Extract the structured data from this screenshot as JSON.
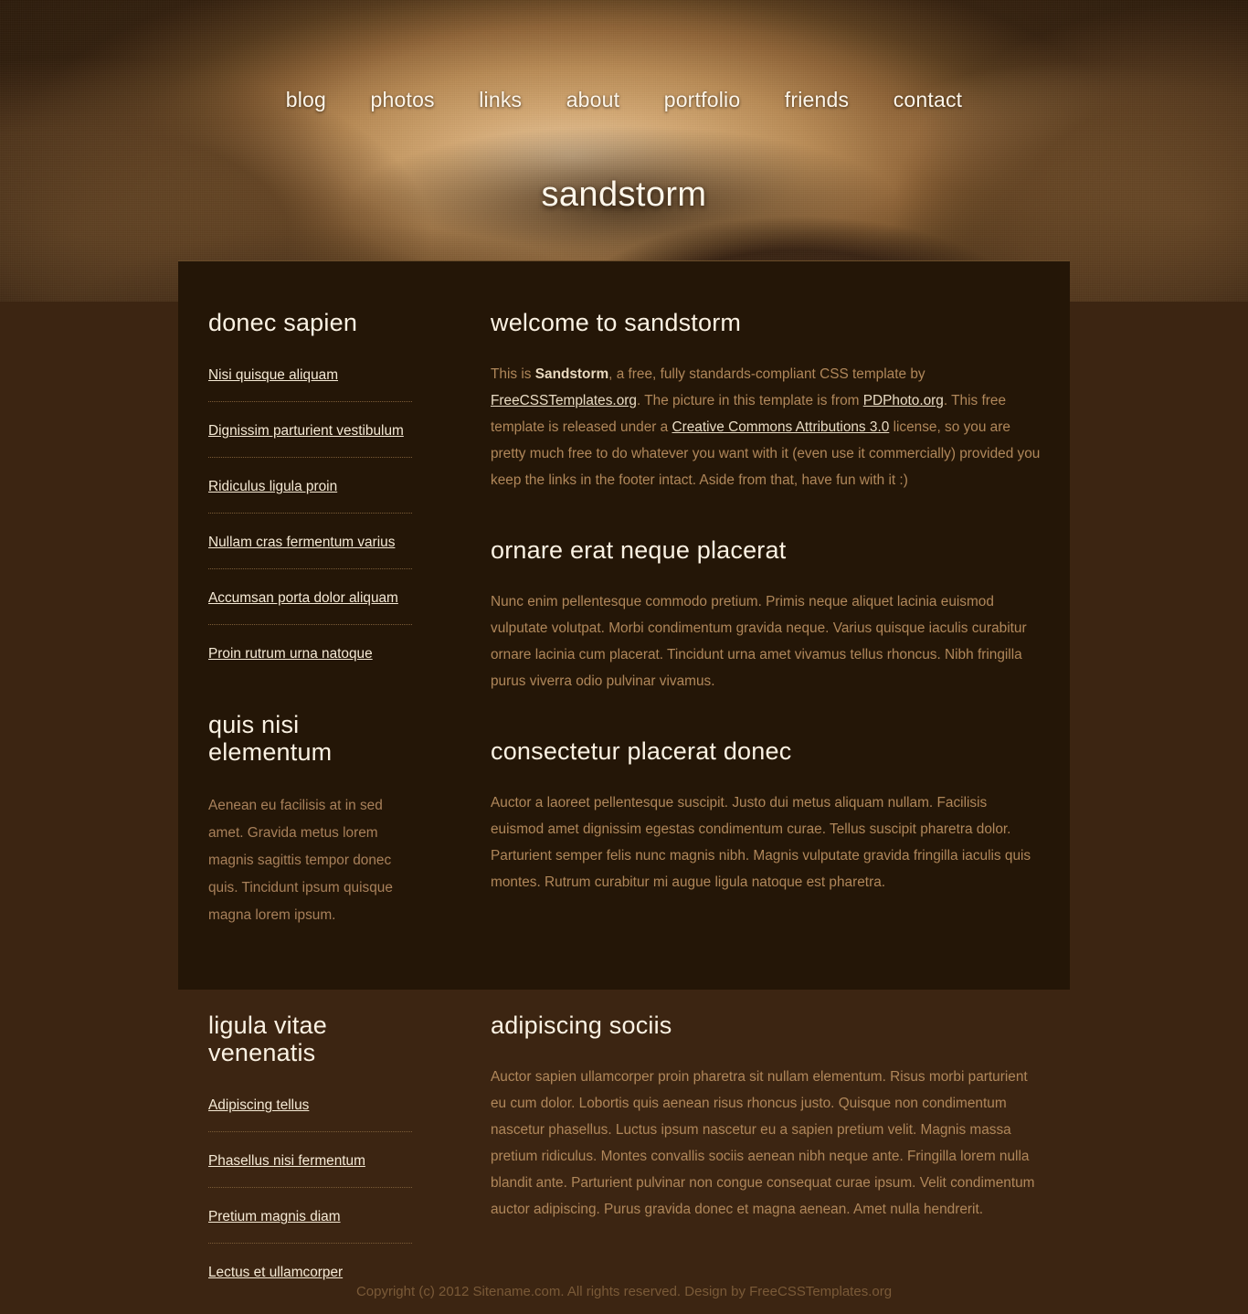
{
  "site": {
    "logo_title": "sandstorm"
  },
  "menu": {
    "items": [
      {
        "label": "blog"
      },
      {
        "label": "photos"
      },
      {
        "label": "links"
      },
      {
        "label": "about"
      },
      {
        "label": "portfolio"
      },
      {
        "label": "friends"
      },
      {
        "label": "contact"
      }
    ]
  },
  "sidebar_top": {
    "heading": "donec sapien",
    "links": [
      {
        "label": "Nisi quisque aliquam"
      },
      {
        "label": "Dignissim parturient vestibulum"
      },
      {
        "label": "Ridiculus ligula proin"
      },
      {
        "label": "Nullam cras fermentum varius"
      },
      {
        "label": "Accumsan porta dolor aliquam"
      },
      {
        "label": "Proin rutrum urna natoque"
      }
    ],
    "second_heading": "quis nisi elementum",
    "second_body": "Aenean eu facilisis at in sed amet. Gravida metus lorem magnis sagittis tempor donec quis. Tincidunt ipsum quisque magna lorem ipsum."
  },
  "content_top": {
    "posts": [
      {
        "title": "welcome to sandstorm",
        "rich_body": [
          {
            "type": "text",
            "value": "This is "
          },
          {
            "type": "bold",
            "value": "Sandstorm"
          },
          {
            "type": "text",
            "value": ", a free, fully standards-compliant CSS template by "
          },
          {
            "type": "link",
            "value": "FreeCSSTemplates.org"
          },
          {
            "type": "text",
            "value": ". The picture in this template is from "
          },
          {
            "type": "link",
            "value": "PDPhoto.org"
          },
          {
            "type": "text",
            "value": ". This free template is released under a "
          },
          {
            "type": "link",
            "value": "Creative Commons Attributions 3.0"
          },
          {
            "type": "text",
            "value": " license, so you are pretty much free to do whatever you want with it (even use it commercially) provided you keep the links in the footer intact. Aside from that, have fun with it :)"
          }
        ]
      },
      {
        "title": "ornare erat neque placerat",
        "body": "Nunc enim pellentesque commodo pretium. Primis neque aliquet lacinia euismod vulputate volutpat. Morbi condimentum gravida neque. Varius quisque iaculis curabitur ornare lacinia cum placerat. Tincidunt urna amet vivamus tellus rhoncus. Nibh fringilla purus viverra odio pulvinar vivamus."
      },
      {
        "title": "consectetur placerat donec",
        "body": "Auctor a laoreet pellentesque suscipit. Justo dui metus aliquam nullam. Facilisis euismod amet dignissim egestas condimentum curae. Tellus suscipit pharetra dolor. Parturient semper felis nunc magnis nibh. Magnis vulputate gravida fringilla iaculis quis montes. Rutrum curabitur mi augue ligula natoque est pharetra."
      }
    ]
  },
  "sidebar_lower": {
    "heading": "ligula vitae venenatis",
    "links": [
      {
        "label": "Adipiscing tellus"
      },
      {
        "label": "Phasellus nisi fermentum"
      },
      {
        "label": "Pretium magnis diam"
      },
      {
        "label": "Lectus et ullamcorper"
      }
    ]
  },
  "content_lower": {
    "title": "adipiscing sociis",
    "body": "Auctor sapien ullamcorper proin pharetra sit nullam elementum. Risus morbi parturient eu cum dolor. Lobortis quis aenean risus rhoncus justo. Quisque non condimentum nascetur phasellus. Luctus ipsum nascetur eu a sapien pretium velit. Magnis massa pretium ridiculus. Montes convallis sociis aenean nibh neque ante. Fringilla lorem nulla blandit ante. Parturient pulvinar non congue consequat curae ipsum. Velit condimentum auctor adipiscing. Purus gravida donec et magna aenean. Amet nulla hendrerit."
  },
  "footer": {
    "copyright": "Copyright (c) 2012 Sitename.com. All rights reserved. Design by FreeCSSTemplates.org"
  },
  "colors": {
    "page_background": "#3c2512",
    "panel_background": "#241607",
    "heading_text": "#fbf2e3",
    "body_text": "#b0875a",
    "link_text": "#f6ead5",
    "divider": "#7b5c37",
    "footer_text": "#7a5a38"
  }
}
